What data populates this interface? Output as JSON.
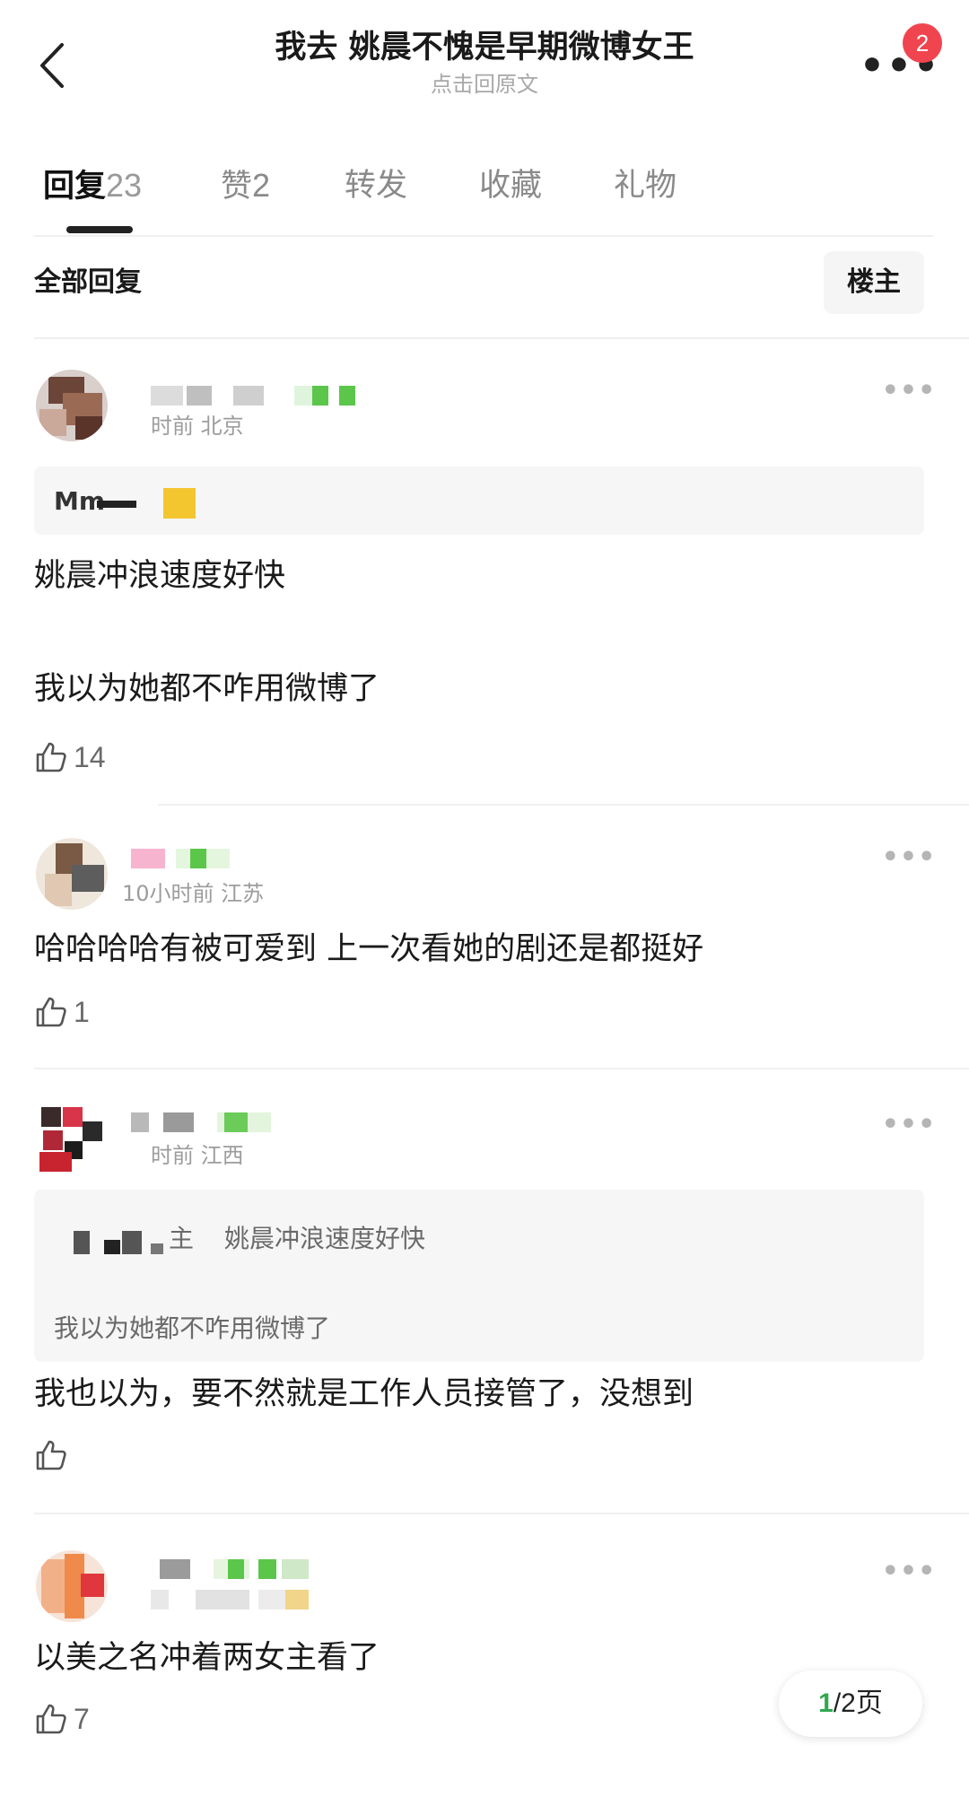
{
  "header": {
    "title": "我去 姚晨不愧是早期微博女王",
    "subtitle": "点击回原文",
    "badge_count": "2"
  },
  "tabs": [
    {
      "label": "回复",
      "count": "23"
    },
    {
      "label": "赞",
      "count": "2"
    },
    {
      "label": "转发",
      "count": ""
    },
    {
      "label": "收藏",
      "count": ""
    },
    {
      "label": "礼物",
      "count": ""
    }
  ],
  "filter": {
    "label": "全部回复",
    "owner_button": "楼主"
  },
  "comments": [
    {
      "meta": "时前 北京",
      "quote_fragment": "Mm",
      "lines": [
        "姚晨冲浪速度好快",
        "我以为她都不咋用微博了"
      ],
      "likes": "14"
    },
    {
      "meta": "10小时前 江苏",
      "lines": [
        "哈哈哈哈有被可爱到 上一次看她的剧还是都挺好"
      ],
      "likes": "1"
    },
    {
      "meta": "时前 江西",
      "quote": {
        "owner_tag": "主",
        "line1": "姚晨冲浪速度好快",
        "line2": "我以为她都不咋用微博了"
      },
      "lines": [
        "我也以为，要不然就是工作人员接管了，没想到"
      ],
      "likes": ""
    },
    {
      "meta": "",
      "lines": [
        "以美之名冲着两女主看了"
      ],
      "likes": "7"
    }
  ],
  "pager": {
    "current": "1",
    "total": "/2",
    "unit": "页"
  },
  "colors": {
    "badge": "#f0454f",
    "pager_current": "#2fa84f",
    "tab_active": "#111111",
    "tab_inactive": "#8a8a8a"
  }
}
